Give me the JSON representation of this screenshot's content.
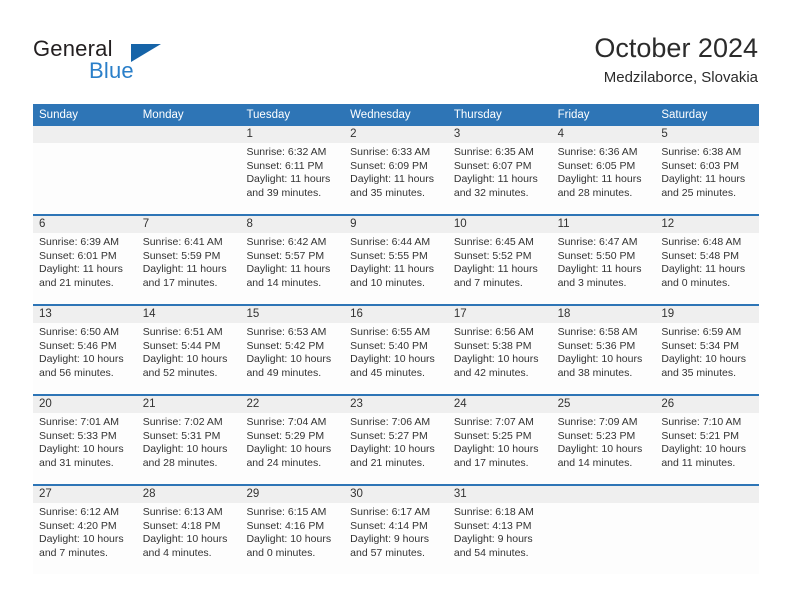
{
  "brand": {
    "word1": "General",
    "word2": "Blue",
    "triangle_color": "#1664a8",
    "blue_text_color": "#2a7fc9"
  },
  "header": {
    "title": "October 2024",
    "location": "Medzilaborce, Slovakia"
  },
  "theme": {
    "header_blue": "#2e75b6",
    "daynum_band": "#efefef",
    "cell_background": "#fdfdfd"
  },
  "calendar": {
    "weekday_headers": [
      "Sunday",
      "Monday",
      "Tuesday",
      "Wednesday",
      "Thursday",
      "Friday",
      "Saturday"
    ],
    "weeks": [
      [
        {
          "day": "",
          "lines": []
        },
        {
          "day": "",
          "lines": []
        },
        {
          "day": "1",
          "lines": [
            "Sunrise: 6:32 AM",
            "Sunset: 6:11 PM",
            "Daylight: 11 hours",
            "and 39 minutes."
          ]
        },
        {
          "day": "2",
          "lines": [
            "Sunrise: 6:33 AM",
            "Sunset: 6:09 PM",
            "Daylight: 11 hours",
            "and 35 minutes."
          ]
        },
        {
          "day": "3",
          "lines": [
            "Sunrise: 6:35 AM",
            "Sunset: 6:07 PM",
            "Daylight: 11 hours",
            "and 32 minutes."
          ]
        },
        {
          "day": "4",
          "lines": [
            "Sunrise: 6:36 AM",
            "Sunset: 6:05 PM",
            "Daylight: 11 hours",
            "and 28 minutes."
          ]
        },
        {
          "day": "5",
          "lines": [
            "Sunrise: 6:38 AM",
            "Sunset: 6:03 PM",
            "Daylight: 11 hours",
            "and 25 minutes."
          ]
        }
      ],
      [
        {
          "day": "6",
          "lines": [
            "Sunrise: 6:39 AM",
            "Sunset: 6:01 PM",
            "Daylight: 11 hours",
            "and 21 minutes."
          ]
        },
        {
          "day": "7",
          "lines": [
            "Sunrise: 6:41 AM",
            "Sunset: 5:59 PM",
            "Daylight: 11 hours",
            "and 17 minutes."
          ]
        },
        {
          "day": "8",
          "lines": [
            "Sunrise: 6:42 AM",
            "Sunset: 5:57 PM",
            "Daylight: 11 hours",
            "and 14 minutes."
          ]
        },
        {
          "day": "9",
          "lines": [
            "Sunrise: 6:44 AM",
            "Sunset: 5:55 PM",
            "Daylight: 11 hours",
            "and 10 minutes."
          ]
        },
        {
          "day": "10",
          "lines": [
            "Sunrise: 6:45 AM",
            "Sunset: 5:52 PM",
            "Daylight: 11 hours",
            "and 7 minutes."
          ]
        },
        {
          "day": "11",
          "lines": [
            "Sunrise: 6:47 AM",
            "Sunset: 5:50 PM",
            "Daylight: 11 hours",
            "and 3 minutes."
          ]
        },
        {
          "day": "12",
          "lines": [
            "Sunrise: 6:48 AM",
            "Sunset: 5:48 PM",
            "Daylight: 11 hours",
            "and 0 minutes."
          ]
        }
      ],
      [
        {
          "day": "13",
          "lines": [
            "Sunrise: 6:50 AM",
            "Sunset: 5:46 PM",
            "Daylight: 10 hours",
            "and 56 minutes."
          ]
        },
        {
          "day": "14",
          "lines": [
            "Sunrise: 6:51 AM",
            "Sunset: 5:44 PM",
            "Daylight: 10 hours",
            "and 52 minutes."
          ]
        },
        {
          "day": "15",
          "lines": [
            "Sunrise: 6:53 AM",
            "Sunset: 5:42 PM",
            "Daylight: 10 hours",
            "and 49 minutes."
          ]
        },
        {
          "day": "16",
          "lines": [
            "Sunrise: 6:55 AM",
            "Sunset: 5:40 PM",
            "Daylight: 10 hours",
            "and 45 minutes."
          ]
        },
        {
          "day": "17",
          "lines": [
            "Sunrise: 6:56 AM",
            "Sunset: 5:38 PM",
            "Daylight: 10 hours",
            "and 42 minutes."
          ]
        },
        {
          "day": "18",
          "lines": [
            "Sunrise: 6:58 AM",
            "Sunset: 5:36 PM",
            "Daylight: 10 hours",
            "and 38 minutes."
          ]
        },
        {
          "day": "19",
          "lines": [
            "Sunrise: 6:59 AM",
            "Sunset: 5:34 PM",
            "Daylight: 10 hours",
            "and 35 minutes."
          ]
        }
      ],
      [
        {
          "day": "20",
          "lines": [
            "Sunrise: 7:01 AM",
            "Sunset: 5:33 PM",
            "Daylight: 10 hours",
            "and 31 minutes."
          ]
        },
        {
          "day": "21",
          "lines": [
            "Sunrise: 7:02 AM",
            "Sunset: 5:31 PM",
            "Daylight: 10 hours",
            "and 28 minutes."
          ]
        },
        {
          "day": "22",
          "lines": [
            "Sunrise: 7:04 AM",
            "Sunset: 5:29 PM",
            "Daylight: 10 hours",
            "and 24 minutes."
          ]
        },
        {
          "day": "23",
          "lines": [
            "Sunrise: 7:06 AM",
            "Sunset: 5:27 PM",
            "Daylight: 10 hours",
            "and 21 minutes."
          ]
        },
        {
          "day": "24",
          "lines": [
            "Sunrise: 7:07 AM",
            "Sunset: 5:25 PM",
            "Daylight: 10 hours",
            "and 17 minutes."
          ]
        },
        {
          "day": "25",
          "lines": [
            "Sunrise: 7:09 AM",
            "Sunset: 5:23 PM",
            "Daylight: 10 hours",
            "and 14 minutes."
          ]
        },
        {
          "day": "26",
          "lines": [
            "Sunrise: 7:10 AM",
            "Sunset: 5:21 PM",
            "Daylight: 10 hours",
            "and 11 minutes."
          ]
        }
      ],
      [
        {
          "day": "27",
          "lines": [
            "Sunrise: 6:12 AM",
            "Sunset: 4:20 PM",
            "Daylight: 10 hours",
            "and 7 minutes."
          ]
        },
        {
          "day": "28",
          "lines": [
            "Sunrise: 6:13 AM",
            "Sunset: 4:18 PM",
            "Daylight: 10 hours",
            "and 4 minutes."
          ]
        },
        {
          "day": "29",
          "lines": [
            "Sunrise: 6:15 AM",
            "Sunset: 4:16 PM",
            "Daylight: 10 hours",
            "and 0 minutes."
          ]
        },
        {
          "day": "30",
          "lines": [
            "Sunrise: 6:17 AM",
            "Sunset: 4:14 PM",
            "Daylight: 9 hours",
            "and 57 minutes."
          ]
        },
        {
          "day": "31",
          "lines": [
            "Sunrise: 6:18 AM",
            "Sunset: 4:13 PM",
            "Daylight: 9 hours",
            "and 54 minutes."
          ]
        },
        {
          "day": "",
          "lines": []
        },
        {
          "day": "",
          "lines": []
        }
      ]
    ]
  }
}
